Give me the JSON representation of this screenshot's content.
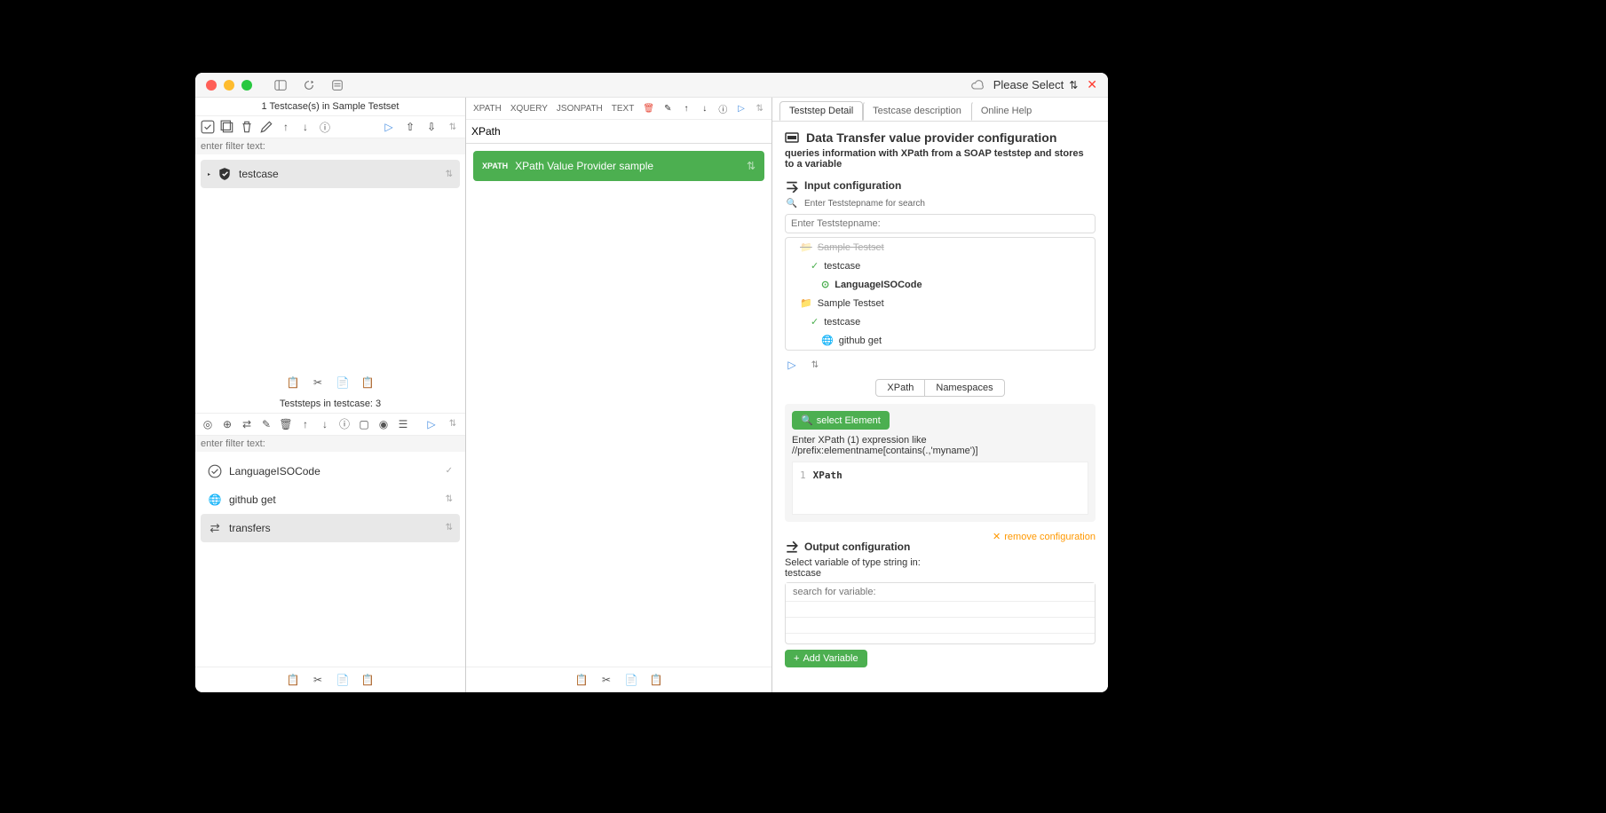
{
  "titlebar": {
    "dropdown": "Please Select"
  },
  "left": {
    "title": "1 Testcase(s) in Sample Testset",
    "filter_placeholder": "enter filter text:",
    "testcase_label": "testcase",
    "testcase_handle": "⇅",
    "steps_title": "Teststeps in testcase: 3",
    "steps_filter_placeholder": "enter filter text:",
    "steps": [
      {
        "label": "LanguageISOCode",
        "status": "ok",
        "icon": "check"
      },
      {
        "label": "github get",
        "status": "",
        "icon": "globe",
        "handle": "⇅"
      },
      {
        "label": "transfers",
        "status": "",
        "icon": "transfer",
        "handle": "⇅"
      }
    ]
  },
  "mid": {
    "tabs": [
      "XPATH",
      "XQUERY",
      "JSONPath",
      "Text"
    ],
    "xpath_value": "XPath",
    "item_badge": "XPATH",
    "item_label": "XPath Value Provider sample"
  },
  "right": {
    "tabs": {
      "detail": "Teststep Detail",
      "desc": "Testcase description",
      "help": "Online Help"
    },
    "title": "Data Transfer value provider configuration",
    "subtitle": "queries information with XPath from a SOAP teststep and stores to a variable",
    "input_section": "Input configuration",
    "search_hint": "Enter Teststepname for search",
    "search_placeholder": "Enter Teststepname:",
    "tree": {
      "set1_label": "Sample Testset",
      "tc1_label": "testcase",
      "lang_label": "LanguageISOCode",
      "set2_label": "Sample Testset",
      "tc2_label": "testcase",
      "gh_label": "github get"
    },
    "inner_tabs": {
      "xpath": "XPath",
      "ns": "Namespaces"
    },
    "select_element": "select Element",
    "xpath_hint": "Enter XPath (1) expression like //prefix:elementname[contains(.,'myname')]",
    "code_line": "1",
    "code_text": "XPath",
    "output_section": "Output configuration",
    "output_hint": "Select variable of type string in: testcase",
    "remove_link": "remove configuration",
    "var_search_placeholder": "search for variable:",
    "add_var": "Add Variable"
  }
}
